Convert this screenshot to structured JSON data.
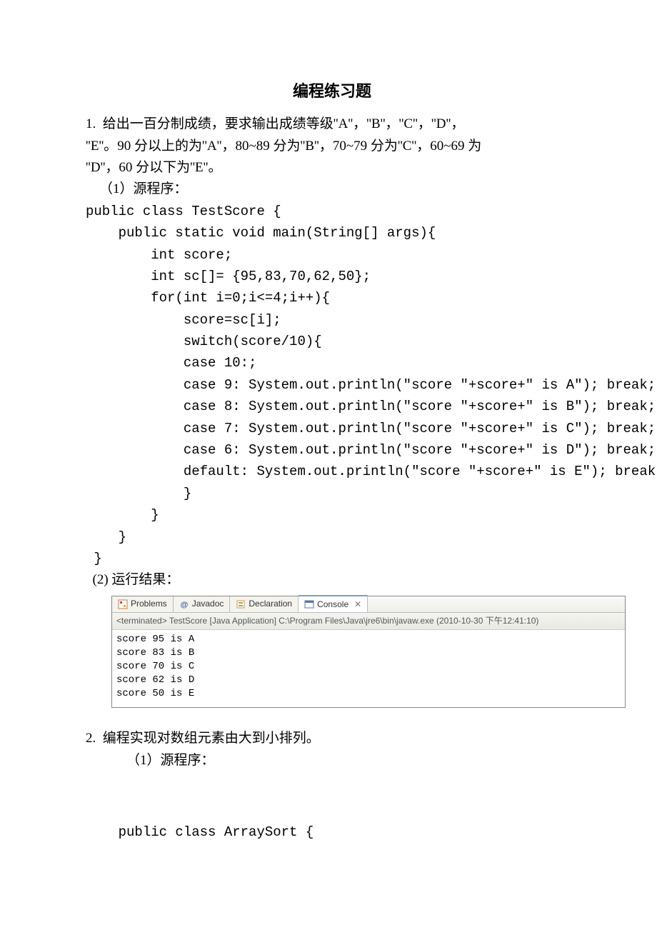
{
  "title": "编程练习题",
  "q1": {
    "l1": "1.  给出一百分制成绩，要求输出成绩等级''A''，''B''，''C''，''D''，",
    "l2": "''E''。90 分以上的为''A''，80~89 分为''B''，70~79 分为''C''，60~69 为",
    "l3": "''D''，60 分以下为''E''。",
    "sub1": "（1）源程序：",
    "code": {
      "c1": "public class TestScore {",
      "c2": "    public static void main(String[] args){",
      "c3": "        int score;",
      "c4": "        int sc[]= {95,83,70,62,50};",
      "c5": "        for(int i=0;i<=4;i++){",
      "c6": "            score=sc[i];",
      "c7": "            switch(score/10){",
      "c8": "            case 10:;",
      "c9": "            case 9: System.out.println(\"score \"+score+\" is A\"); break;",
      "c10": "            case 8: System.out.println(\"score \"+score+\" is B\"); break;",
      "c11": "            case 7: System.out.println(\"score \"+score+\" is C\"); break;",
      "c12": "            case 6: System.out.println(\"score \"+score+\" is D\"); break;",
      "c13": "            default: System.out.println(\"score \"+score+\" is E\"); break;",
      "c14": "            }",
      "c15": "        }",
      "c16": "    }",
      "c17": " }"
    },
    "sub2": "  (2) 运行结果："
  },
  "ide": {
    "tabs": {
      "t1": "Problems",
      "t2": "Javadoc",
      "t3": "Declaration",
      "t4": "Console"
    },
    "terminated": "<terminated> TestScore [Java Application] C:\\Program Files\\Java\\jre6\\bin\\javaw.exe (2010-10-30 下午12:41:10)",
    "out": "score 95 is A\nscore 83 is B\nscore 70 is C\nscore 62 is D\nscore 50 is E"
  },
  "q2": {
    "l1": "2.  编程实现对数组元素由大到小排列。",
    "sub1": "（1）源程序：",
    "code1": "    public class ArraySort {"
  }
}
